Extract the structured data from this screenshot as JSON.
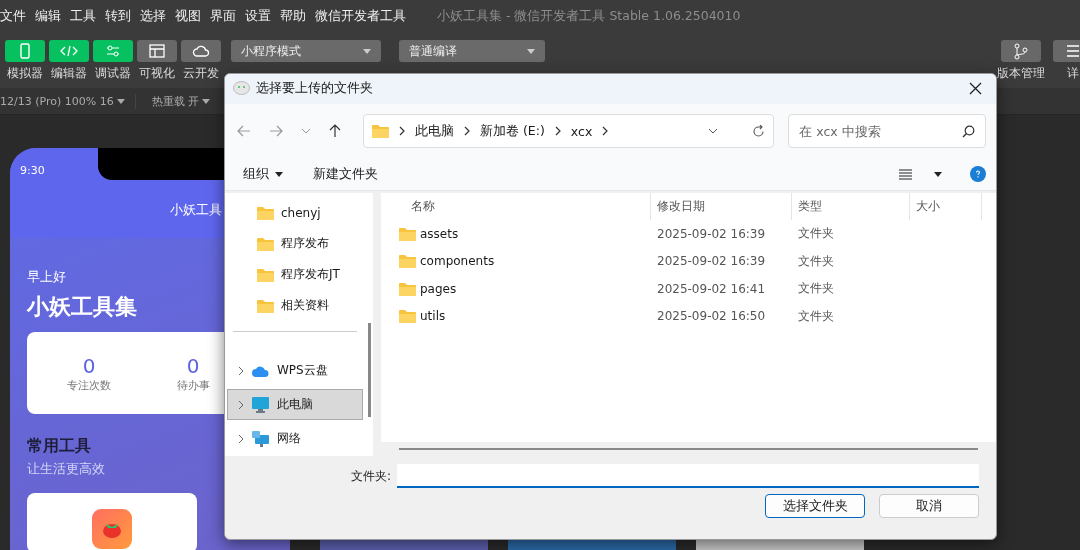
{
  "menu": [
    "文件",
    "编辑",
    "工具",
    "转到",
    "选择",
    "视图",
    "界面",
    "设置",
    "帮助",
    "微信开发者工具"
  ],
  "window_title": "小妖工具集 - 微信开发者工具 Stable 1.06.2504010",
  "toolbar_left": [
    {
      "label": "模拟器",
      "kind": "phone",
      "selected": true
    },
    {
      "label": "编辑器",
      "kind": "code",
      "selected": true
    },
    {
      "label": "调试器",
      "kind": "sliders",
      "selected": true
    },
    {
      "label": "可视化",
      "kind": "layout",
      "selected": false
    },
    {
      "label": "云开发",
      "kind": "cloud",
      "selected": false
    }
  ],
  "mode_select": "小程序模式",
  "compile_select": "普通编译",
  "toolbar_right": [
    {
      "label": "版本管理",
      "kind": "branch"
    },
    {
      "label": "详",
      "kind": "menu"
    }
  ],
  "sim_bar": {
    "device": "12/13 (Pro) 100% 16",
    "hot_reload": "热重载 开"
  },
  "phone": {
    "time": "9:30",
    "nav_title": "小妖工具",
    "greeting": "早上好",
    "app_name": "小妖工具集",
    "stats": [
      {
        "value": "0",
        "label": "专注次数"
      },
      {
        "value": "0",
        "label": "待办事"
      }
    ],
    "section_title": "常用工具",
    "section_subtitle": "让生活更高效"
  },
  "dialog": {
    "title": "选择要上传的文件夹",
    "breadcrumb": [
      "此电脑",
      "新加卷 (E:)",
      "xcx"
    ],
    "search": {
      "placeholder": "在 xcx 中搜索"
    },
    "commands": {
      "organize": "组织",
      "new_folder": "新建文件夹"
    },
    "quick_access": [
      "chenyj",
      "程序发布",
      "程序发布JT",
      "相关资料"
    ],
    "tree": [
      {
        "label": "WPS云盘",
        "kind": "cloud",
        "selected": false
      },
      {
        "label": "此电脑",
        "kind": "pc",
        "selected": true
      },
      {
        "label": "网络",
        "kind": "network",
        "selected": false
      }
    ],
    "columns": [
      "名称",
      "修改日期",
      "类型",
      "大小"
    ],
    "rows": [
      {
        "name": "assets",
        "modified": "2025-09-02 16:39",
        "type": "文件夹"
      },
      {
        "name": "components",
        "modified": "2025-09-02 16:39",
        "type": "文件夹"
      },
      {
        "name": "pages",
        "modified": "2025-09-02 16:41",
        "type": "文件夹"
      },
      {
        "name": "utils",
        "modified": "2025-09-02 16:50",
        "type": "文件夹"
      }
    ],
    "folder_label": "文件夹:",
    "buttons": [
      {
        "label": "选择文件夹",
        "default": true
      },
      {
        "label": "取消",
        "default": false
      }
    ]
  }
}
